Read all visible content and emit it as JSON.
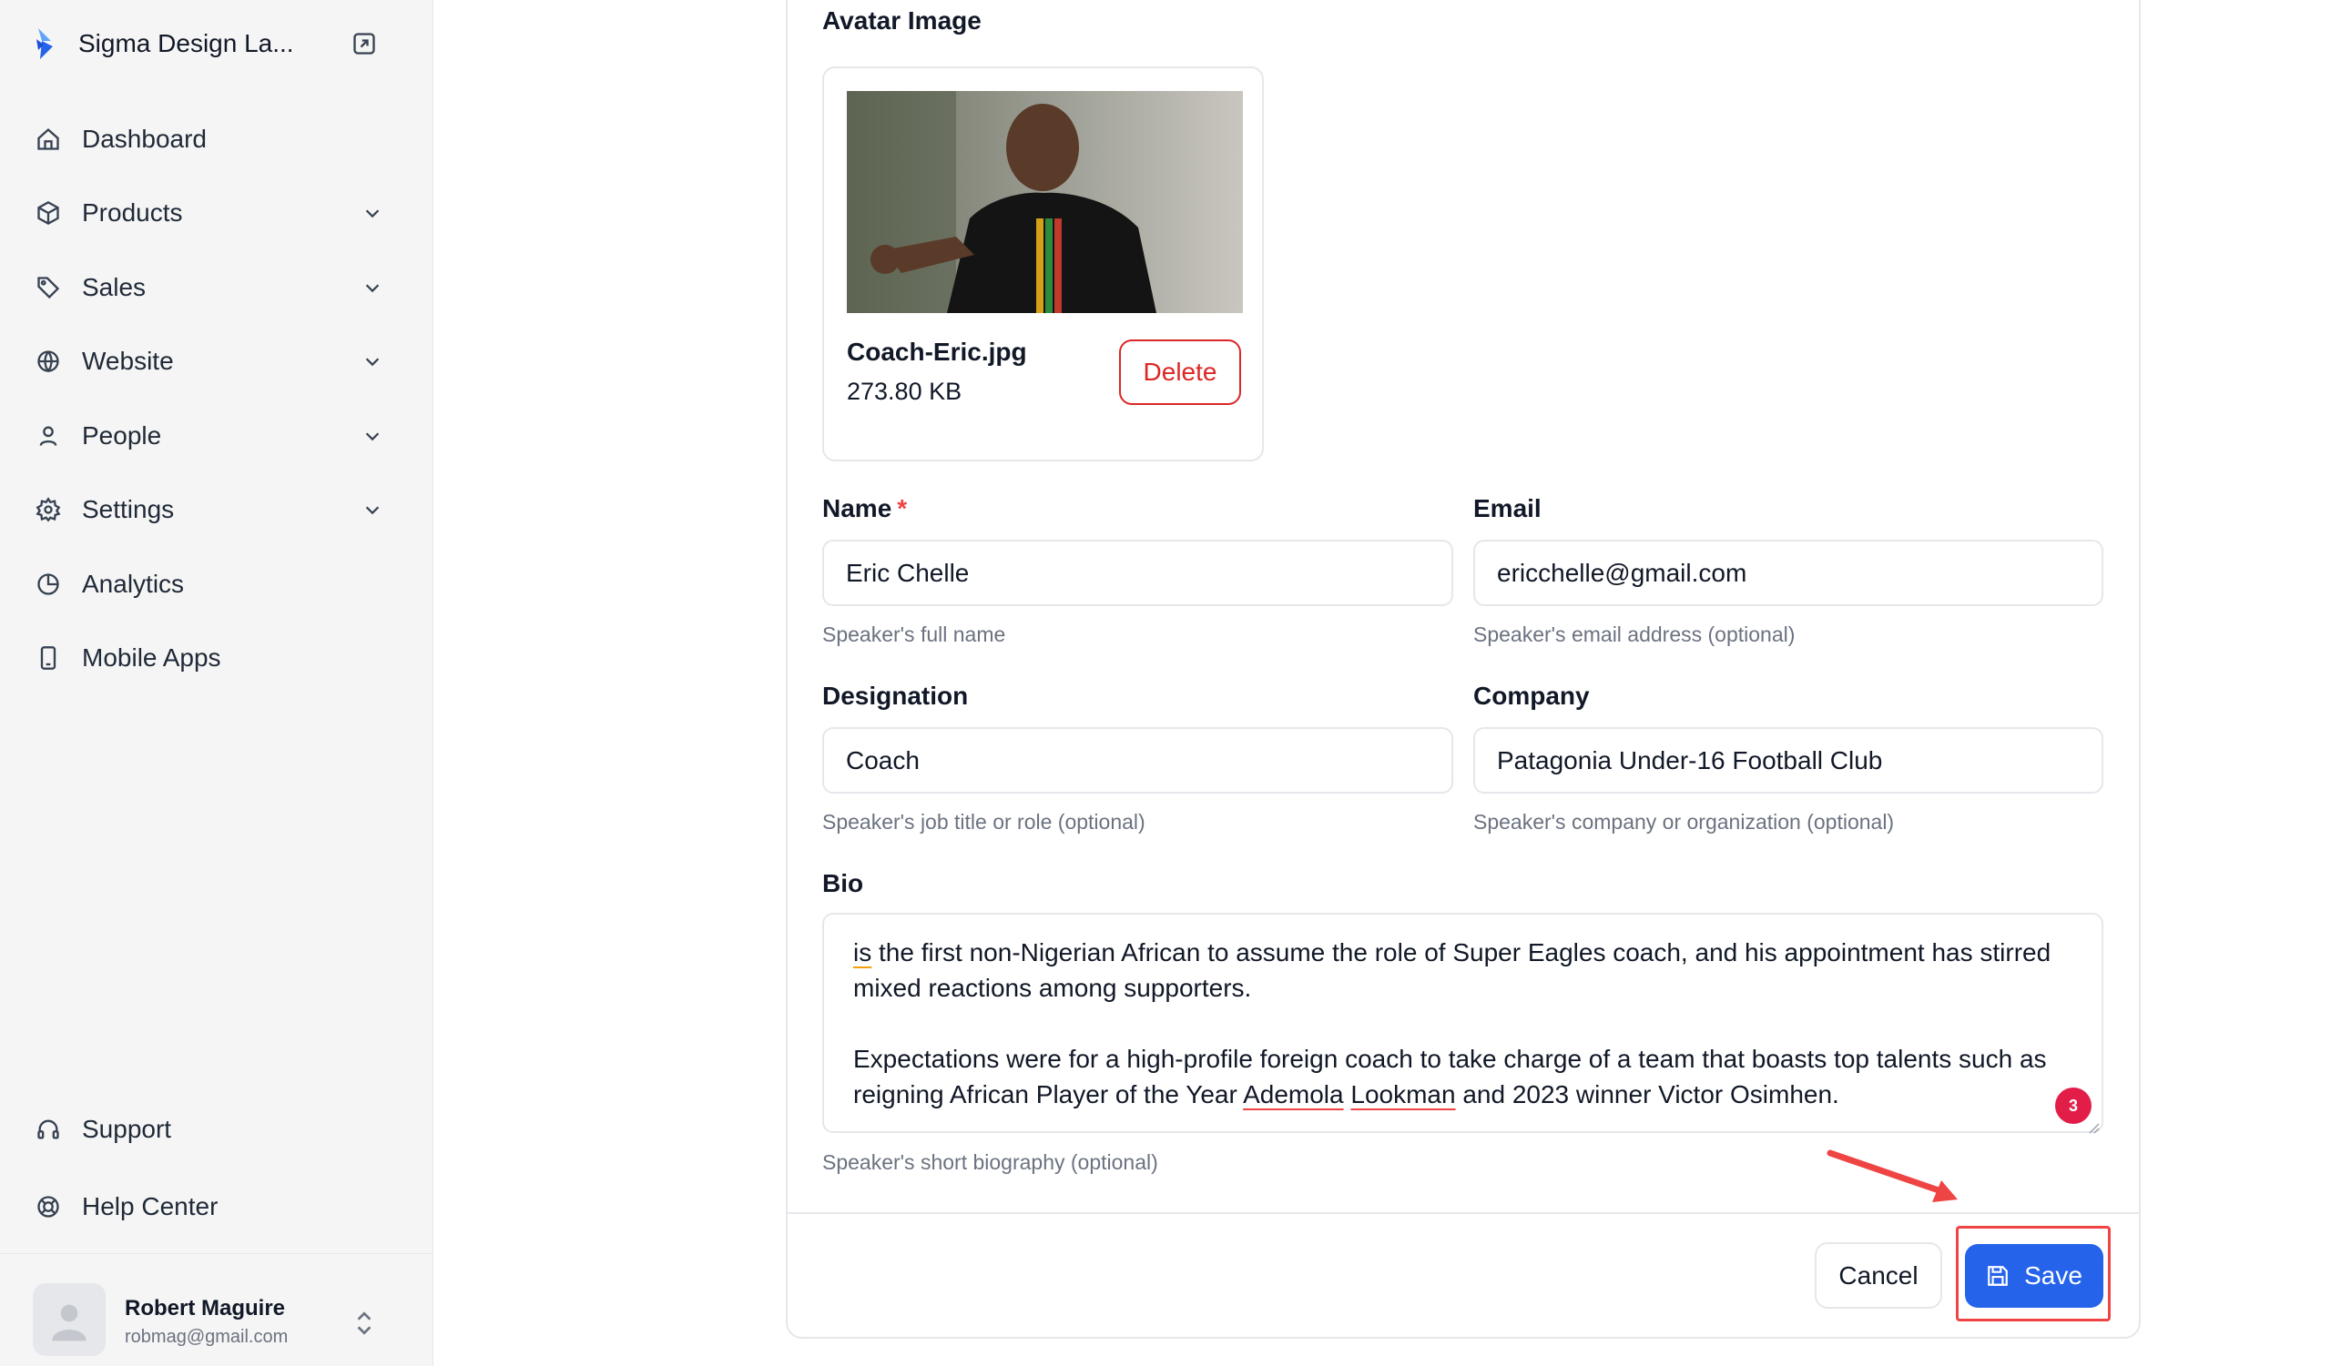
{
  "brand": {
    "name": "Sigma Design La...",
    "accent": "#2563eb"
  },
  "nav": {
    "items": [
      {
        "label": "Dashboard",
        "icon": "home-icon",
        "has_chevron": false
      },
      {
        "label": "Products",
        "icon": "box-icon",
        "has_chevron": true
      },
      {
        "label": "Sales",
        "icon": "tag-icon",
        "has_chevron": true
      },
      {
        "label": "Website",
        "icon": "globe-icon",
        "has_chevron": true
      },
      {
        "label": "People",
        "icon": "user-icon",
        "has_chevron": true
      },
      {
        "label": "Settings",
        "icon": "gear-icon",
        "has_chevron": true
      },
      {
        "label": "Analytics",
        "icon": "pie-chart-icon",
        "has_chevron": false
      },
      {
        "label": "Mobile Apps",
        "icon": "mobile-icon",
        "has_chevron": false
      }
    ],
    "bottom": [
      {
        "label": "Support",
        "icon": "headset-icon"
      },
      {
        "label": "Help Center",
        "icon": "lifebuoy-icon"
      }
    ]
  },
  "user": {
    "name": "Robert Maguire",
    "email": "robmag@gmail.com"
  },
  "form": {
    "avatar_label": "Avatar Image",
    "file": {
      "name": "Coach-Eric.jpg",
      "size": "273.80 KB",
      "delete_label": "Delete"
    },
    "name": {
      "label": "Name",
      "required_mark": "*",
      "value": "Eric Chelle",
      "help": "Speaker's full name"
    },
    "email": {
      "label": "Email",
      "value": "ericchelle@gmail.com",
      "help": "Speaker's email address (optional)"
    },
    "designation": {
      "label": "Designation",
      "value": "Coach",
      "help": "Speaker's job title or role (optional)"
    },
    "company": {
      "label": "Company",
      "value": "Patagonia Under-16 Football Club",
      "help": "Speaker's company or organization (optional)"
    },
    "bio": {
      "label": "Bio",
      "p1_word": "is",
      "p1_rest": " the first non-Nigerian African to assume the role of Super Eagles coach, and his appointment has stirred mixed reactions among supporters.",
      "p2_start": "Expectations were for a high-profile foreign coach to take charge of a team that boasts top talents such as reigning African Player of the Year ",
      "p2_word1": "Ademola",
      "p2_word2": "Lookman",
      "p2_end": " and 2023 winner Victor Osimhen.",
      "badge_count": "3",
      "help": "Speaker's short biography (optional)"
    }
  },
  "actions": {
    "cancel_label": "Cancel",
    "save_label": "Save"
  },
  "colors": {
    "save_button": "#2563eb",
    "delete": "#dc2626",
    "annotation": "#ef4444"
  }
}
